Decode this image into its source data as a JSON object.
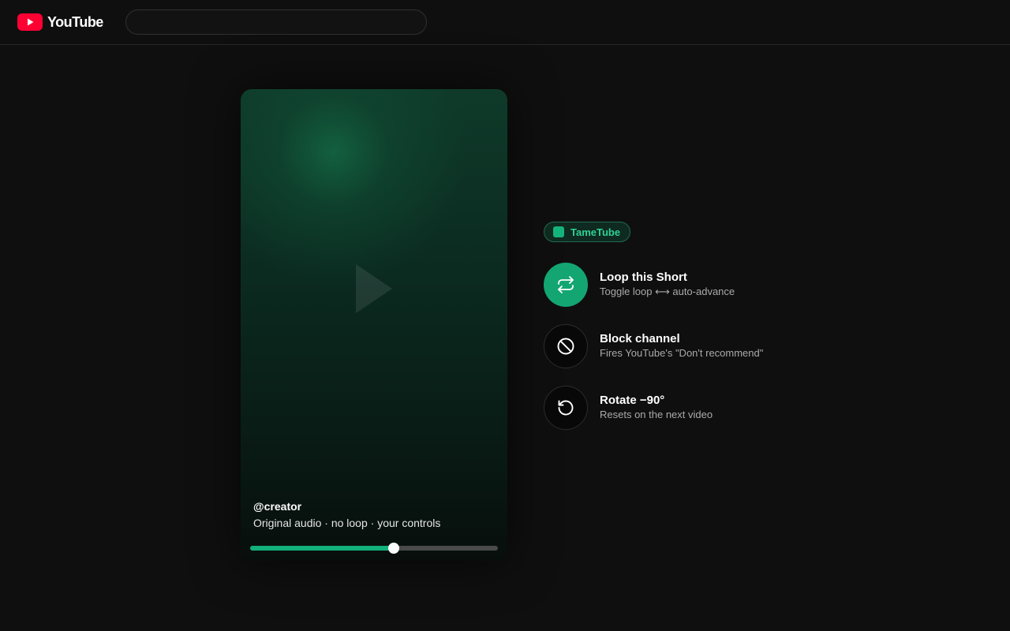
{
  "header": {
    "logo_text": "YouTube",
    "search_placeholder": ""
  },
  "player": {
    "creator": "@creator",
    "caption": "Original audio · no loop · your controls",
    "progress_fraction": 0.58
  },
  "panel": {
    "badge_label": "TameTube",
    "actions": [
      {
        "title": "Loop this Short",
        "subtitle": "Toggle loop ⟷ auto-advance",
        "icon": "loop-icon"
      },
      {
        "title": "Block channel",
        "subtitle": "Fires YouTube's \"Don't recommend\"",
        "icon": "block-icon"
      },
      {
        "title": "Rotate −90°",
        "subtitle": "Resets on the next video",
        "icon": "rotate-ccw-icon"
      }
    ]
  },
  "colors": {
    "brand_red": "#ff0033",
    "accent_green": "#13a673",
    "background": "#0f0f0f"
  }
}
